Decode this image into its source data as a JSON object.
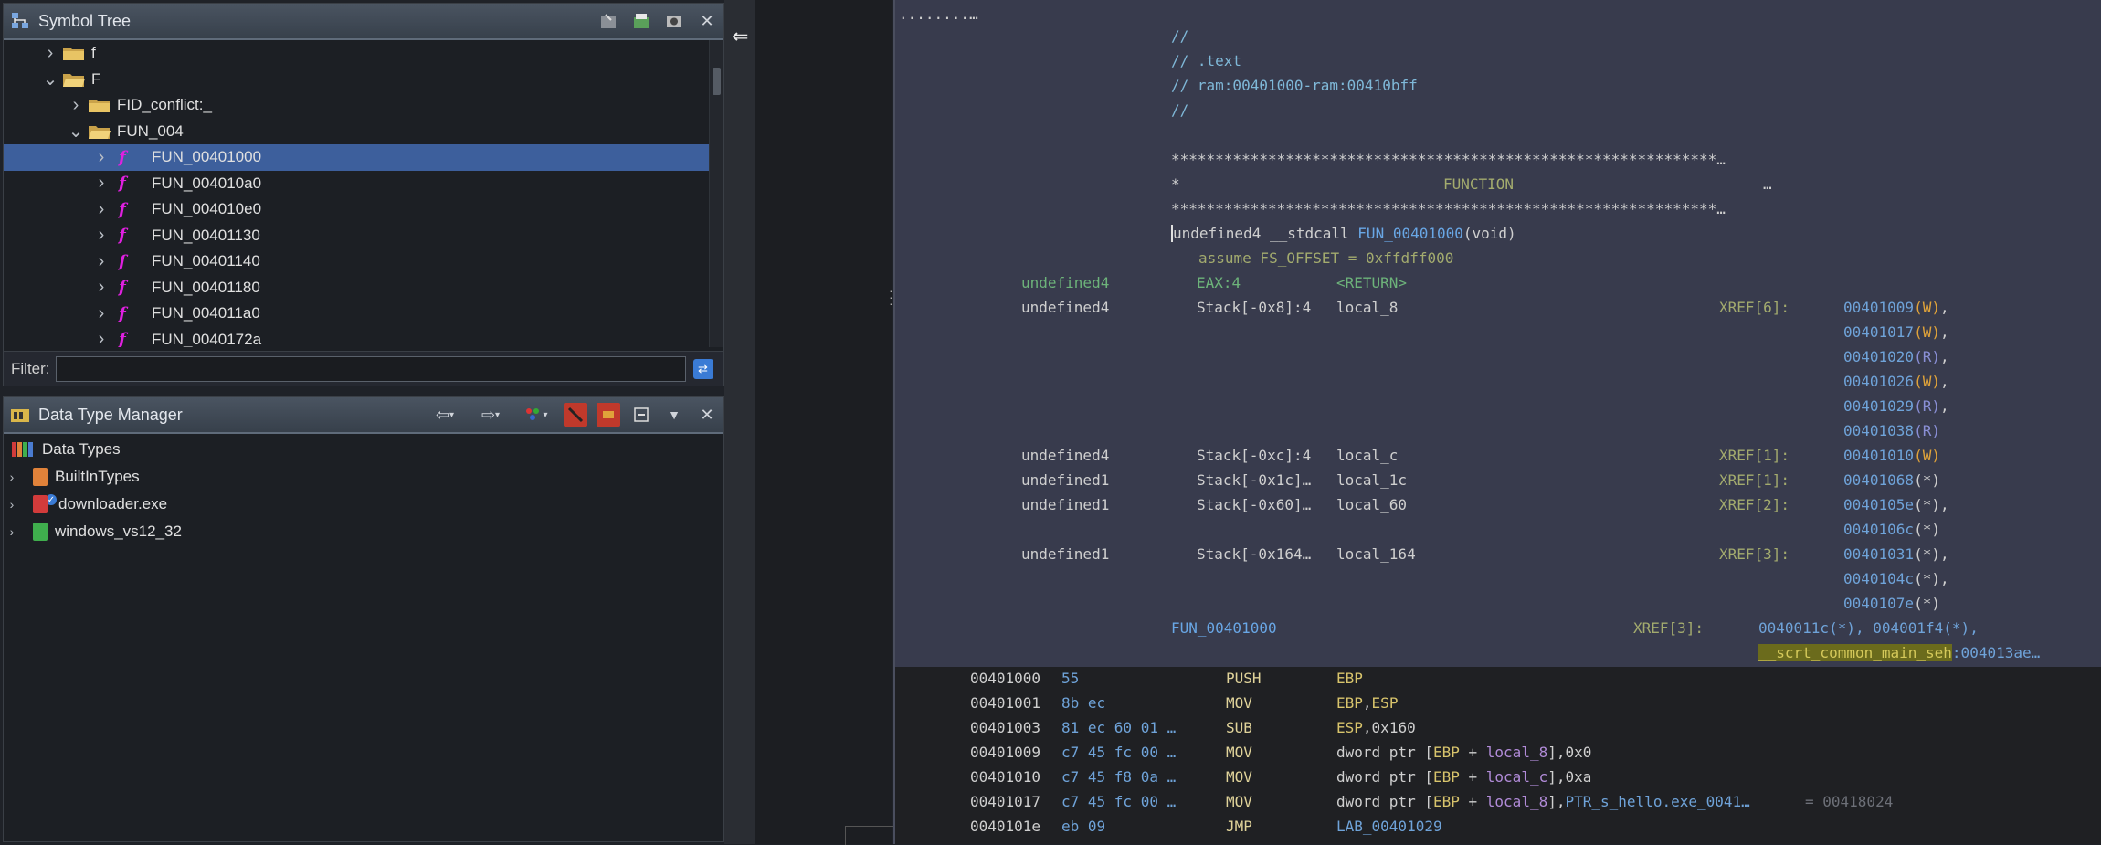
{
  "symbol_tree": {
    "title": "Symbol Tree",
    "rows": [
      {
        "label": "f",
        "indent": 0,
        "kind": "folder",
        "expanded": false
      },
      {
        "label": "F",
        "indent": 0,
        "kind": "folder-open",
        "expanded": true
      },
      {
        "label": "FID_conflict:_",
        "indent": 1,
        "kind": "folder",
        "expanded": false
      },
      {
        "label": "FUN_004",
        "indent": 1,
        "kind": "folder-open",
        "expanded": true
      },
      {
        "label": "FUN_00401000",
        "indent": 2,
        "kind": "function",
        "selected": true
      },
      {
        "label": "FUN_004010a0",
        "indent": 2,
        "kind": "function"
      },
      {
        "label": "FUN_004010e0",
        "indent": 2,
        "kind": "function"
      },
      {
        "label": "FUN_00401130",
        "indent": 2,
        "kind": "function"
      },
      {
        "label": "FUN_00401140",
        "indent": 2,
        "kind": "function"
      },
      {
        "label": "FUN_00401180",
        "indent": 2,
        "kind": "function"
      },
      {
        "label": "FUN_004011a0",
        "indent": 2,
        "kind": "function"
      },
      {
        "label": "FUN_0040172a",
        "indent": 2,
        "kind": "function"
      }
    ],
    "filter_label": "Filter:",
    "filter_value": ""
  },
  "data_type_manager": {
    "title": "Data Type Manager",
    "root": "Data Types",
    "items": [
      {
        "label": "BuiltInTypes",
        "color": "#e0823a"
      },
      {
        "label": "downloader.exe",
        "color": "#d23b3b"
      },
      {
        "label": "windows_vs12_32",
        "color": "#3fae4d"
      }
    ]
  },
  "listing": {
    "header_dots": "........…",
    "comment_block": [
      "//",
      "// .text",
      "// ram:00401000-ram:00410bff",
      "//"
    ],
    "stars": "**************************************************************…",
    "function_banner_left": "*",
    "function_banner_text": "FUNCTION",
    "function_banner_right": "…",
    "signature": {
      "ret_type": "undefined4",
      "conv": "__stdcall",
      "name": "FUN_00401000",
      "params": "(void)"
    },
    "assume": "assume FS_OFFSET = 0xffdff000",
    "variables": [
      {
        "type": "undefined4",
        "storage": "EAX:4",
        "name": "<RETURN>",
        "xref": "",
        "refs": []
      },
      {
        "type": "undefined4",
        "storage": "Stack[-0x8]:4",
        "name": "local_8",
        "xref": "XREF[6]:",
        "refs": [
          {
            "a": "00401009",
            "t": "(W)"
          },
          {
            "a": "00401017",
            "t": "(W)"
          },
          {
            "a": "00401020",
            "t": "(R)"
          },
          {
            "a": "00401026",
            "t": "(W)"
          },
          {
            "a": "00401029",
            "t": "(R)"
          },
          {
            "a": "00401038",
            "t": "(R)"
          }
        ]
      },
      {
        "type": "undefined4",
        "storage": "Stack[-0xc]:4",
        "name": "local_c",
        "xref": "XREF[1]:",
        "refs": [
          {
            "a": "00401010",
            "t": "(W)"
          }
        ]
      },
      {
        "type": "undefined1",
        "storage": "Stack[-0x1c]…",
        "name": "local_1c",
        "xref": "XREF[1]:",
        "refs": [
          {
            "a": "00401068",
            "t": "(*)"
          }
        ]
      },
      {
        "type": "undefined1",
        "storage": "Stack[-0x60]…",
        "name": "local_60",
        "xref": "XREF[2]:",
        "refs": [
          {
            "a": "0040105e",
            "t": "(*)"
          },
          {
            "a": "0040106c",
            "t": "(*)"
          }
        ]
      },
      {
        "type": "undefined1",
        "storage": "Stack[-0x164…",
        "name": "local_164",
        "xref": "XREF[3]:",
        "refs": [
          {
            "a": "00401031",
            "t": "(*)"
          },
          {
            "a": "0040104c",
            "t": "(*)"
          },
          {
            "a": "0040107e",
            "t": "(*)"
          }
        ]
      }
    ],
    "func_label": "FUN_00401000",
    "func_xref": "XREF[3]:",
    "func_xref_refs": "0040011c(*), 004001f4(*),",
    "func_xref_highlight": "__scrt_common_main_seh",
    "func_xref_tail": ":004013ae…",
    "instructions": [
      {
        "addr": "00401000",
        "bytes": "55",
        "mnem": "PUSH",
        "ops": "EBP"
      },
      {
        "addr": "00401001",
        "bytes": "8b ec",
        "mnem": "MOV",
        "ops": "EBP,ESP"
      },
      {
        "addr": "00401003",
        "bytes": "81 ec 60 01 …",
        "mnem": "SUB",
        "ops": "ESP,0x160"
      },
      {
        "addr": "00401009",
        "bytes": "c7 45 fc 00 …",
        "mnem": "MOV",
        "ops": "dword ptr [EBP + local_8],0x0"
      },
      {
        "addr": "00401010",
        "bytes": "c7 45 f8 0a …",
        "mnem": "MOV",
        "ops": "dword ptr [EBP + local_c],0xa"
      },
      {
        "addr": "00401017",
        "bytes": "c7 45 fc 00 …",
        "mnem": "MOV",
        "ops": "dword ptr [EBP + local_8],PTR_s_hello.exe_0041…",
        "trail": "= 00418024"
      },
      {
        "addr": "0040101e",
        "bytes": "eb 09",
        "mnem": "JMP",
        "ops": "LAB_00401029"
      }
    ]
  }
}
